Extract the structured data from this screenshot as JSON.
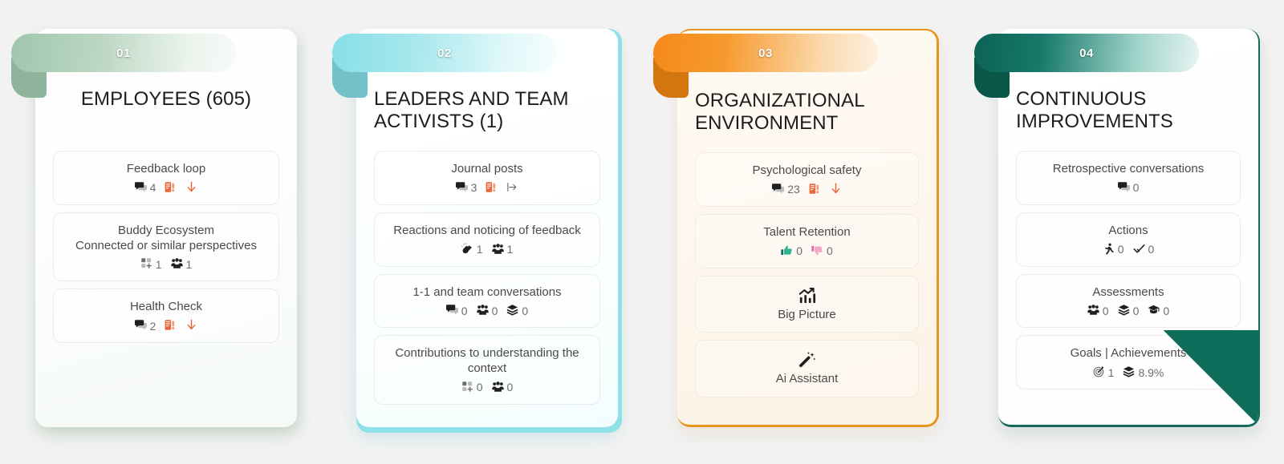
{
  "page": {
    "background": "#f2f2f2",
    "card_count": 4
  },
  "cards": [
    {
      "number": "01",
      "title": "EMPLOYEES (605)",
      "accent": "#9fc6ad",
      "accent_fold": "#8eb59c",
      "title_align": "center",
      "metrics": [
        {
          "label": "Feedback loop",
          "stats": [
            {
              "icon": "comments-icon",
              "value": "4"
            },
            {
              "icon": "survey-alert-icon",
              "value": ""
            },
            {
              "icon": "arrow-down-icon",
              "value": ""
            }
          ]
        },
        {
          "label": "Buddy Ecosystem\nConnected or similar perspectives",
          "stats": [
            {
              "icon": "add-grid-icon",
              "value": "1"
            },
            {
              "icon": "people-group-icon",
              "value": "1"
            }
          ]
        },
        {
          "label": "Health Check",
          "stats": [
            {
              "icon": "comments-icon",
              "value": "2"
            },
            {
              "icon": "survey-alert-icon",
              "value": ""
            },
            {
              "icon": "arrow-down-icon",
              "value": ""
            }
          ]
        }
      ]
    },
    {
      "number": "02",
      "title": "LEADERS AND TEAM ACTIVISTS (1)",
      "accent": "#88dfe7",
      "accent_fold": "#73c2ca",
      "title_align": "left",
      "metrics": [
        {
          "label": "Journal posts",
          "stats": [
            {
              "icon": "comments-icon",
              "value": "3"
            },
            {
              "icon": "survey-alert-icon",
              "value": ""
            },
            {
              "icon": "arrow-right-bar-icon",
              "value": ""
            }
          ]
        },
        {
          "label": "Reactions and noticing of feedback",
          "stats": [
            {
              "icon": "clap-hands-icon",
              "value": "1"
            },
            {
              "icon": "people-group-icon",
              "value": "1"
            }
          ]
        },
        {
          "label": "1-1 and team conversations",
          "stats": [
            {
              "icon": "comments-icon",
              "value": "0"
            },
            {
              "icon": "people-group-icon",
              "value": "0"
            },
            {
              "icon": "layers-icon",
              "value": "0"
            }
          ]
        },
        {
          "label": "Contributions to understanding the context",
          "stats": [
            {
              "icon": "add-grid-icon",
              "value": "0"
            },
            {
              "icon": "people-group-icon",
              "value": "0"
            }
          ]
        }
      ]
    },
    {
      "number": "03",
      "title": "ORGANIZATIONAL ENVIRONMENT",
      "accent": "#f5891a",
      "accent_fold": "#d4760f",
      "title_align": "left",
      "metrics": [
        {
          "label": "Psychological safety",
          "stats": [
            {
              "icon": "comments-icon",
              "value": "23"
            },
            {
              "icon": "survey-alert-icon",
              "value": ""
            },
            {
              "icon": "arrow-down-icon",
              "value": ""
            }
          ]
        },
        {
          "label": "Talent Retention",
          "stats": [
            {
              "icon": "thumbs-up-icon",
              "value": "0"
            },
            {
              "icon": "thumbs-down-icon",
              "value": "0"
            }
          ]
        },
        {
          "label": "Big Picture",
          "icon_top": "chart-growth-icon",
          "stats": []
        },
        {
          "label": "Ai Assistant",
          "icon_top": "magic-wand-icon",
          "stats": []
        }
      ]
    },
    {
      "number": "04",
      "title": "CONTINUOUS IMPROVEMENTS",
      "accent": "#0c6355",
      "accent_fold": "#0a5649",
      "title_align": "left",
      "metrics": [
        {
          "label": "Retrospective conversations",
          "stats": [
            {
              "icon": "comments-icon",
              "value": "0"
            }
          ]
        },
        {
          "label": "Actions",
          "stats": [
            {
              "icon": "running-person-icon",
              "value": "0"
            },
            {
              "icon": "check-icon",
              "value": "0"
            }
          ]
        },
        {
          "label": "Assessments",
          "stats": [
            {
              "icon": "people-group-icon",
              "value": "0"
            },
            {
              "icon": "layers-icon",
              "value": "0"
            },
            {
              "icon": "graduation-cap-icon",
              "value": "0"
            }
          ]
        },
        {
          "label": "Goals | Achievements",
          "stats": [
            {
              "icon": "target-icon",
              "value": "1"
            },
            {
              "icon": "layers-icon",
              "value": "8.9%"
            }
          ]
        }
      ]
    }
  ]
}
